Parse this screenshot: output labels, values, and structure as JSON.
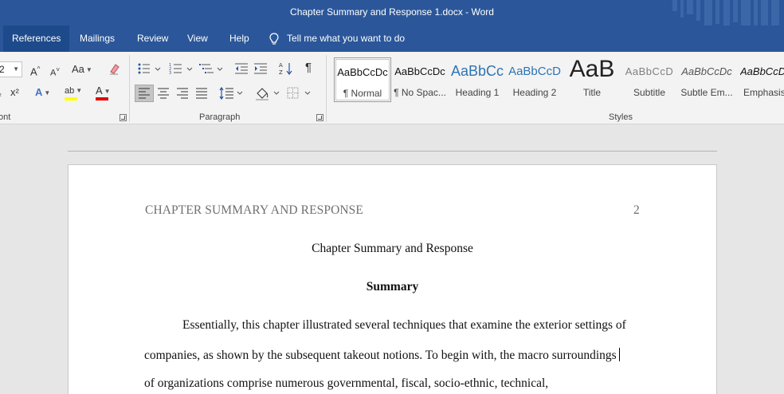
{
  "window": {
    "title": "Chapter Summary and Response 1.docx  -  Word"
  },
  "tabs": [
    {
      "label": "References",
      "active": true
    },
    {
      "label": "Mailings"
    },
    {
      "label": "Review"
    },
    {
      "label": "View"
    },
    {
      "label": "Help"
    }
  ],
  "tell_me": {
    "placeholder": "Tell me what you want to do",
    "icon": "lightbulb-icon"
  },
  "ribbon": {
    "font_group": {
      "label": "ont",
      "font_size": "2",
      "grow_font_icon": "A^",
      "shrink_font_icon": "A˅",
      "change_case_label": "Aa",
      "subscript_label": "₂",
      "superscript_label": "x²",
      "text_effects_label": "A",
      "highlight_label": "ab",
      "font_color_label": "A",
      "highlight_color": "#ffff00",
      "font_color": "#e00000"
    },
    "paragraph_group": {
      "label": "Paragraph"
    },
    "styles_group": {
      "label": "Styles",
      "items": [
        {
          "sample": "AaBbCcDc",
          "name": "¶ Normal",
          "selected": true
        },
        {
          "sample": "AaBbCcDc",
          "name": "¶ No Spac..."
        },
        {
          "sample": "AaBbCc",
          "name": "Heading 1"
        },
        {
          "sample": "AaBbCcD",
          "name": "Heading 2"
        },
        {
          "sample": "AaB",
          "name": "Title"
        },
        {
          "sample": "AaBbCcD",
          "name": "Subtitle"
        },
        {
          "sample": "AaBbCcDc",
          "name": "Subtle Em..."
        },
        {
          "sample": "AaBbCcD",
          "name": "Emphasis"
        }
      ]
    }
  },
  "document": {
    "header_text": "CHAPTER SUMMARY AND RESPONSE",
    "page_number": "2",
    "title": "Chapter Summary and Response",
    "heading": "Summary",
    "lines": [
      "Essentially, this chapter illustrated several techniques that examine the exterior settings of",
      "companies, as shown by the subsequent takeout notions. To begin with, the macro surroundings",
      "of organizations comprise numerous governmental, fiscal, socio-ethnic, technical,"
    ]
  },
  "colors": {
    "ribbon_blue": "#2b579a",
    "active_tab": "#1d4a8a"
  }
}
